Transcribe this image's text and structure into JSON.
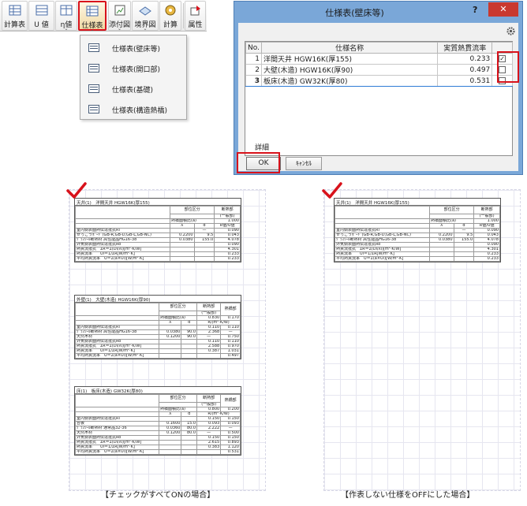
{
  "toolbar": {
    "buttons": [
      {
        "label": "計算表",
        "icon": "calc-table-icon"
      },
      {
        "label": "U 値",
        "icon": "u-value-icon"
      },
      {
        "label": "η値",
        "icon": "eta-value-icon"
      },
      {
        "label": "仕様表",
        "icon": "spec-table-icon",
        "sub": "⌄"
      },
      {
        "label": "添付図",
        "icon": "attached-drawing-icon",
        "sub": "⌄"
      },
      {
        "label": "境界図",
        "icon": "boundary-drawing-icon",
        "sub": "⌄"
      },
      {
        "label": "計算",
        "icon": "calculate-icon"
      },
      {
        "label": "属性",
        "icon": "attribute-icon"
      }
    ]
  },
  "menu": {
    "items": [
      "仕様表(壁床等)",
      "仕様表(開口部)",
      "仕様表(基礎)",
      "仕様表(構造熱橋)"
    ]
  },
  "dialog": {
    "title": "仕様表(壁床等)",
    "help": "?",
    "close": "✕",
    "columns": {
      "no": "No.",
      "name": "仕様名称",
      "value": "実質熱貫流率"
    },
    "rows": [
      {
        "no": "1",
        "name": "洋間天井 HGW16K(厚155)",
        "value": "0.233",
        "checked": true
      },
      {
        "no": "2",
        "name": "大壁(木造) HGW16K(厚90)",
        "value": "0.497",
        "checked": false
      },
      {
        "no": "3",
        "name": "板床(木造) GW32K(厚80)",
        "value": "0.531",
        "checked": false
      }
    ],
    "detail_label": "詳細",
    "ok_label": "OK",
    "cancel_label": "ｷｬﾝｾﾙ"
  },
  "report": {
    "ceiling": {
      "caption": "天井(1)　洋間天井 HGW16K(厚155)",
      "head": [
        "部位区分",
        "断熱部",
        "(一般部)",
        "熱橋面積比(a)",
        "1.000",
        "λ",
        "d",
        "R値/U値"
      ],
      "rows": [
        [
          "室内側表面熱伝達抵抗Ri",
          "",
          "—",
          "0.090"
        ],
        [
          "せっこうﾎﾞｰﾄﾞ(GB-R,GB-D,GB-L,GB-NC)",
          "0.2200",
          "9.5",
          "0.043"
        ],
        [
          "ｸﾞﾗｽｳｰﾙ断熱材 高性能品HG16-38",
          "0.0380",
          "155.0",
          "4.078"
        ],
        [
          "外気側表面熱伝達抵抗Ro",
          "",
          "",
          "0.090"
        ],
        [
          "熱貫流抵抗　ΣR＝Σ(Di/λi)[m²·K/W]",
          "",
          "",
          "4.301"
        ],
        [
          "熱貫流率　　Ui＝1/ΣR[W/m²·K]",
          "",
          "",
          "0.233"
        ],
        [
          "平均熱貫流率　U＝Σ(a×Ui)[W/m²·K]",
          "",
          "",
          "0.233"
        ]
      ]
    },
    "wall": {
      "caption": "外壁(1)　大壁(木造) HGW16K(厚90)",
      "head": [
        "部位区分",
        "断熱部",
        "(一般部)",
        "熱橋部",
        "熱橋面積比(a)",
        "0.830",
        "0.170",
        "λ",
        "d",
        "R/(m²·K/W)"
      ],
      "rows": [
        [
          "室内側表面熱伝達抵抗Ri",
          "",
          "",
          "0.110",
          "0.110"
        ],
        [
          "ｸﾞﾗｽｳｰﾙ断熱材 高性能品HG16-38",
          "0.0380",
          "90.0",
          "2.368",
          "—"
        ],
        [
          "天然木材",
          "0.1200",
          "90.0",
          "—",
          "0.750"
        ],
        [
          "外気側表面熱伝達抵抗Ro",
          "",
          "",
          "0.110",
          "0.110"
        ],
        [
          "熱貫流抵抗　ΣR＝Σ(Di/λi)[m²·K/W]",
          "",
          "",
          "2.588",
          "0.970"
        ],
        [
          "熱貫流率　　Ui＝1/ΣR[W/m²·K]",
          "",
          "",
          "0.387",
          "1.031"
        ],
        [
          "平均熱貫流率　U＝Σ(a×Ui)[W/m²·K]",
          "",
          "",
          "",
          "0.497"
        ]
      ]
    },
    "floor": {
      "caption": "床(1)　板床(木造) GW32K(厚80)",
      "head": [
        "部位区分",
        "断熱部",
        "(一般部)",
        "熱橋部",
        "熱橋面積比(a)",
        "0.800",
        "0.200",
        "λ",
        "d",
        "R/(m²·K/W)"
      ],
      "rows": [
        [
          "室内側表面熱伝達抵抗Ri",
          "",
          "",
          "0.150",
          "0.150"
        ],
        [
          "合板",
          "0.1600",
          "15.0",
          "0.093",
          "0.093"
        ],
        [
          "ｸﾞﾗｽｳｰﾙ断熱材 通常品32-36",
          "0.0360",
          "80.0",
          "2.222",
          "—"
        ],
        [
          "天然木材",
          "0.1200",
          "80.0",
          "—",
          "0.500"
        ],
        [
          "外気側表面熱伝達抵抗Ro",
          "",
          "",
          "0.150",
          "0.150"
        ],
        [
          "熱貫流抵抗　ΣR＝Σ(Di/λi)[m²·K/W]",
          "",
          "",
          "2.615",
          "0.893"
        ],
        [
          "熱貫流率　　Ui＝1/ΣR[W/m²·K]",
          "",
          "",
          "0.383",
          "1.120"
        ],
        [
          "平均熱貫流率　U＝Σ(a×Ui)[W/m²·K]",
          "",
          "",
          "",
          "0.531"
        ]
      ]
    }
  },
  "captions": {
    "left": "【チェックがすべてONの場合】",
    "right": "【作表しない仕様をOFFにした場合】"
  },
  "colors": {
    "highlight": "#d8121b",
    "title_bar": "#7aa7d8",
    "selection": "#2e7bd6"
  }
}
